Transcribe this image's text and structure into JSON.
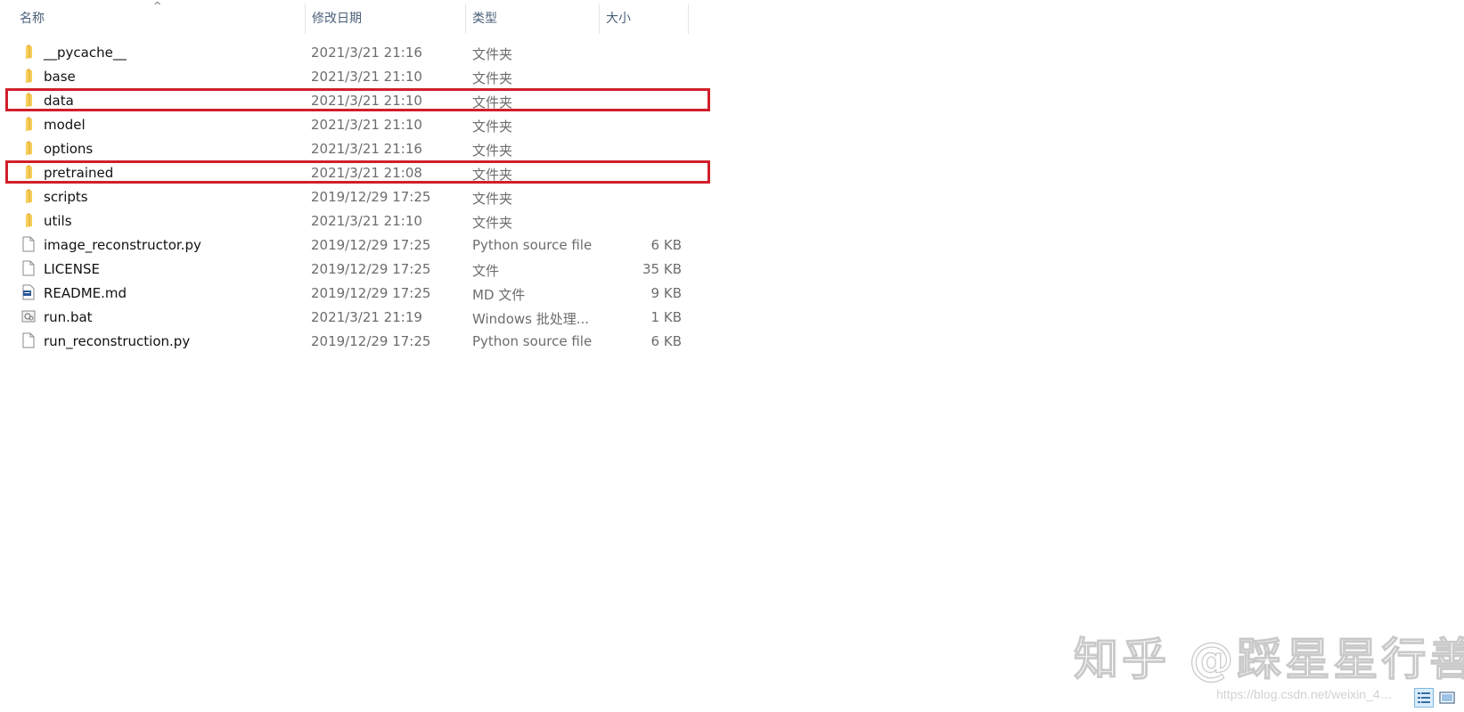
{
  "columns": {
    "name": "名称",
    "date": "修改日期",
    "type": "类型",
    "size": "大小",
    "sort_indicator": "^"
  },
  "files": [
    {
      "name": "__pycache__",
      "date": "2021/3/21 21:16",
      "type": "文件夹",
      "size": "",
      "icon": "folder-icon",
      "highlighted": false
    },
    {
      "name": "base",
      "date": "2021/3/21 21:10",
      "type": "文件夹",
      "size": "",
      "icon": "folder-icon",
      "highlighted": false
    },
    {
      "name": "data",
      "date": "2021/3/21 21:10",
      "type": "文件夹",
      "size": "",
      "icon": "folder-icon",
      "highlighted": true
    },
    {
      "name": "model",
      "date": "2021/3/21 21:10",
      "type": "文件夹",
      "size": "",
      "icon": "folder-icon",
      "highlighted": false
    },
    {
      "name": "options",
      "date": "2021/3/21 21:16",
      "type": "文件夹",
      "size": "",
      "icon": "folder-icon",
      "highlighted": false
    },
    {
      "name": "pretrained",
      "date": "2021/3/21 21:08",
      "type": "文件夹",
      "size": "",
      "icon": "folder-icon",
      "highlighted": true
    },
    {
      "name": "scripts",
      "date": "2019/12/29 17:25",
      "type": "文件夹",
      "size": "",
      "icon": "folder-icon",
      "highlighted": false
    },
    {
      "name": "utils",
      "date": "2021/3/21 21:10",
      "type": "文件夹",
      "size": "",
      "icon": "folder-icon",
      "highlighted": false
    },
    {
      "name": "image_reconstructor.py",
      "date": "2019/12/29 17:25",
      "type": "Python source file",
      "size": "6 KB",
      "icon": "document-icon",
      "highlighted": false
    },
    {
      "name": "LICENSE",
      "date": "2019/12/29 17:25",
      "type": "文件",
      "size": "35 KB",
      "icon": "document-icon",
      "highlighted": false
    },
    {
      "name": "README.md",
      "date": "2019/12/29 17:25",
      "type": "MD 文件",
      "size": "9 KB",
      "icon": "markdown-file-icon",
      "highlighted": false
    },
    {
      "name": "run.bat",
      "date": "2021/3/21 21:19",
      "type": "Windows 批处理...",
      "size": "1 KB",
      "icon": "batch-file-icon",
      "highlighted": false
    },
    {
      "name": "run_reconstruction.py",
      "date": "2019/12/29 17:25",
      "type": "Python source file",
      "size": "6 KB",
      "icon": "document-icon",
      "highlighted": false
    }
  ],
  "watermark": {
    "main": "知乎 @踩星星行善",
    "url": "https://blog.csdn.net/weixin_4…"
  },
  "view_toggles": [
    "details-view-icon",
    "large-icons-view-icon"
  ],
  "colors": {
    "highlight_border": "#d0202a",
    "folder": "#f5c242",
    "header_text": "#4c607a",
    "secondary_text": "#6d6d6d"
  }
}
